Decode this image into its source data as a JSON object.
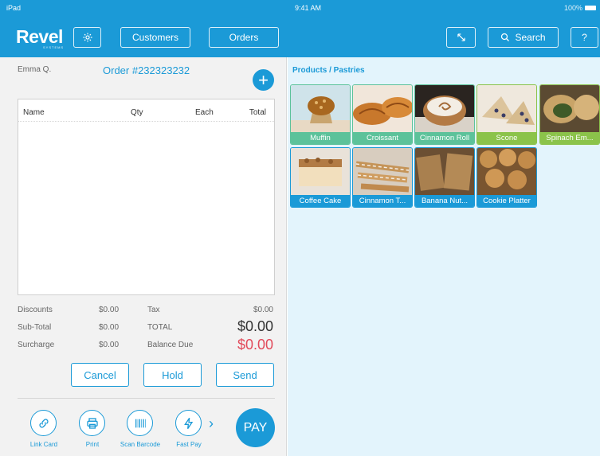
{
  "status_bar": {
    "left": "iPad",
    "time": "9:41 AM",
    "battery": "100%"
  },
  "brand": {
    "name": "Revel",
    "sub": "SYSTEMS"
  },
  "nav": {
    "customers": "Customers",
    "orders": "Orders",
    "search": "Search",
    "help": "?"
  },
  "order": {
    "customer": "Emma Q.",
    "number": "Order #232323232",
    "add": "+",
    "columns": {
      "name": "Name",
      "qty": "Qty",
      "each": "Each",
      "total": "Total"
    },
    "totals": {
      "discounts_label": "Discounts",
      "discounts": "$0.00",
      "subtotal_label": "Sub-Total",
      "subtotal": "$0.00",
      "surcharge_label": "Surcharge",
      "surcharge": "$0.00",
      "tax_label": "Tax",
      "tax": "$0.00",
      "total_label": "TOTAL",
      "total": "$0.00",
      "balance_label": "Balance Due",
      "balance": "$0.00"
    },
    "actions": {
      "cancel": "Cancel",
      "hold": "Hold",
      "send": "Send"
    },
    "tools": {
      "link_card": "Link Card",
      "print": "Print",
      "scan_barcode": "Scan Barcode",
      "fast_pay": "Fast Pay",
      "more": "›",
      "pay": "PAY"
    }
  },
  "products": {
    "breadcrumb": "Products / Pastries",
    "items": [
      {
        "label": "Muffin",
        "color": "#5cc29a"
      },
      {
        "label": "Croissant",
        "color": "#5cc29a"
      },
      {
        "label": "Cinnamon Roll",
        "color": "#5cc29a"
      },
      {
        "label": "Scone",
        "color": "#8bc34a"
      },
      {
        "label": "Spinach Em...",
        "color": "#8bc34a"
      },
      {
        "label": "Coffee Cake",
        "color": "#1b9ad7"
      },
      {
        "label": "Cinnamon T...",
        "color": "#1b9ad7"
      },
      {
        "label": "Banana Nut...",
        "color": "#1b9ad7"
      },
      {
        "label": "Cookie Platter",
        "color": "#1b9ad7"
      }
    ]
  },
  "colors": {
    "brand": "#1b9ad7",
    "balance": "#e24b5b",
    "panel": "#e3f4fc"
  }
}
